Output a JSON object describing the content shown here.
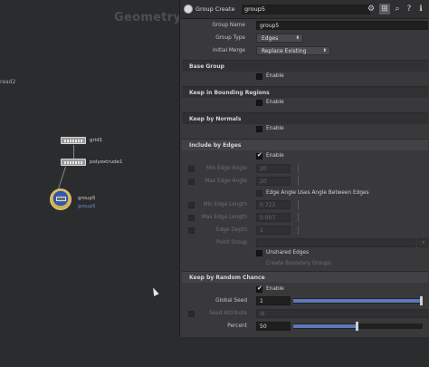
{
  "network": {
    "title": "Geometry",
    "left_label": "read2",
    "nodes": [
      {
        "label": "grid1"
      },
      {
        "label": "polyextrude1"
      },
      {
        "label": "group5",
        "sublabel": "group5"
      }
    ]
  },
  "header": {
    "node_type": "Group Create",
    "node_name": "group5",
    "icons": [
      "gear-icon",
      "pin-icon",
      "search-icon",
      "help-icon",
      "info-icon"
    ]
  },
  "params": {
    "group_name": {
      "label": "Group Name",
      "value": "group5"
    },
    "group_type": {
      "label": "Group Type",
      "value": "Edges"
    },
    "initial_merge": {
      "label": "Initial Merge",
      "value": "Replace Existing"
    }
  },
  "sections": {
    "base_group": {
      "title": "Base Group",
      "enable": "Enable"
    },
    "bounding": {
      "title": "Keep in Bounding Regions",
      "enable": "Enable"
    },
    "normals": {
      "title": "Keep by Normals",
      "enable": "Enable"
    },
    "edges": {
      "title": "Include by Edges",
      "enable": "Enable",
      "min_angle": {
        "label": "Min Edge Angle",
        "value": "20"
      },
      "max_angle": {
        "label": "Max Edge Angle",
        "value": "20"
      },
      "edge_angle_uses": "Edge Angle Uses Angle Between Edges",
      "min_length": {
        "label": "Min Edge Length",
        "value": "0.723"
      },
      "max_length": {
        "label": "Max Edge Length",
        "value": "0.007"
      },
      "edge_depth": {
        "label": "Edge Depth",
        "value": "1"
      },
      "point_group": {
        "label": "Point Group"
      },
      "unshared": "Unshared Edges",
      "create_boundary": "Create Boundary Groups"
    },
    "random": {
      "title": "Keep by Random Chance",
      "enable": "Enable",
      "global_seed": {
        "label": "Global Seed",
        "value": "1",
        "fraction": 1.0
      },
      "seed_attribute": {
        "label": "Seed Attribute",
        "value": "id"
      },
      "percent": {
        "label": "Percent",
        "value": "50",
        "fraction": 0.5
      }
    }
  }
}
